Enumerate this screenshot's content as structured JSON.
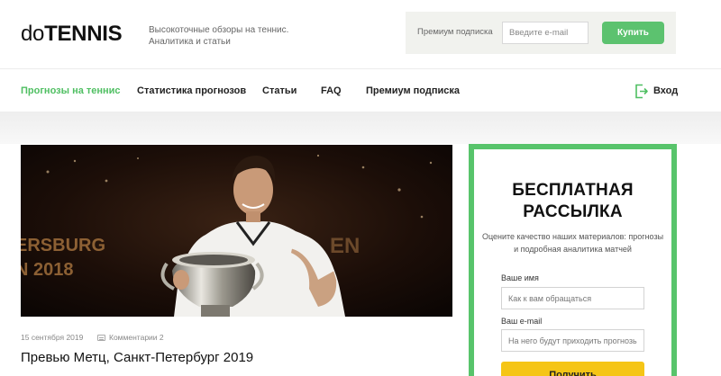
{
  "header": {
    "logo_prefix": "do",
    "logo_main": "TENNIS",
    "tagline": "Высокоточные обзоры на теннис. Аналитика и статьи",
    "premium_label": "Премиум подписка",
    "email_placeholder": "Введите e-mail",
    "buy_label": "Купить"
  },
  "nav": {
    "items": [
      {
        "label": "Прогнозы на теннис",
        "active": true
      },
      {
        "label": "Статистика прогнозов"
      },
      {
        "label": "Статьи"
      },
      {
        "label": "FAQ"
      },
      {
        "label": "Премиум подписка"
      }
    ],
    "login_label": "Вход",
    "login_icon": "login-icon"
  },
  "article": {
    "image_text_1": "ERSBURG",
    "image_text_2": "N 2018",
    "image_text_3": "EN",
    "date": "15 сентября 2019",
    "comments": "Комментарии 2",
    "title": "Превью Метц, Санкт-Петербург 2019"
  },
  "newsletter": {
    "title_line1": "БЕСПЛАТНАЯ",
    "title_line2": "РАССЫЛКА",
    "description": "Оцените качество наших материалов: прогнозы и подробная аналитика матчей",
    "name_label": "Ваше имя",
    "name_placeholder": "Как к вам обращаться",
    "email_label": "Ваш e-mail",
    "email_placeholder": "На него будут приходить прогнозы",
    "button_label": "Получить"
  },
  "colors": {
    "accent_green": "#5cc26f",
    "nav_active": "#4fbf62",
    "button_yellow": "#f5c516"
  }
}
